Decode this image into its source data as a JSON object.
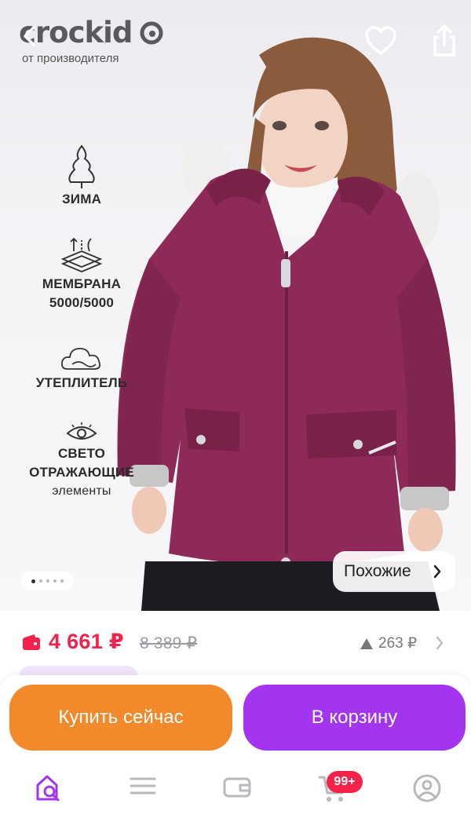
{
  "brand": {
    "logo_text": "crockid",
    "subtitle": "от производителя"
  },
  "icons": {
    "back": "chevron-left-icon",
    "favorite": "heart-icon",
    "share": "share-icon"
  },
  "features": [
    {
      "icon": "tree-icon",
      "label": "ЗИМА"
    },
    {
      "icon": "membrane-icon",
      "label": "МЕМБРАНА 5000/5000"
    },
    {
      "icon": "cloud-icon",
      "label": "УТЕПЛИТЕЛЬ"
    },
    {
      "icon": "eye-icon",
      "label_line1": "СВЕТО",
      "label_line2": "ОТРАЖАЮЩИЕ",
      "label_line3": "элементы"
    }
  ],
  "carousel": {
    "total": 5,
    "active": 1
  },
  "similar_button": {
    "label": "Похожие"
  },
  "price": {
    "current": "4 661 ₽",
    "old": "8 389 ₽",
    "drop": "263 ₽"
  },
  "actions": {
    "buy_now": "Купить сейчас",
    "add_to_cart": "В корзину"
  },
  "nav": {
    "cart_badge": "99+"
  },
  "colors": {
    "price": "#f2224d",
    "buy_now": "#f28a2c",
    "add_to_cart": "#a335f0",
    "nav_active": "#a335f0",
    "badge": "#f5224a",
    "jacket": "#8e2a5a"
  }
}
